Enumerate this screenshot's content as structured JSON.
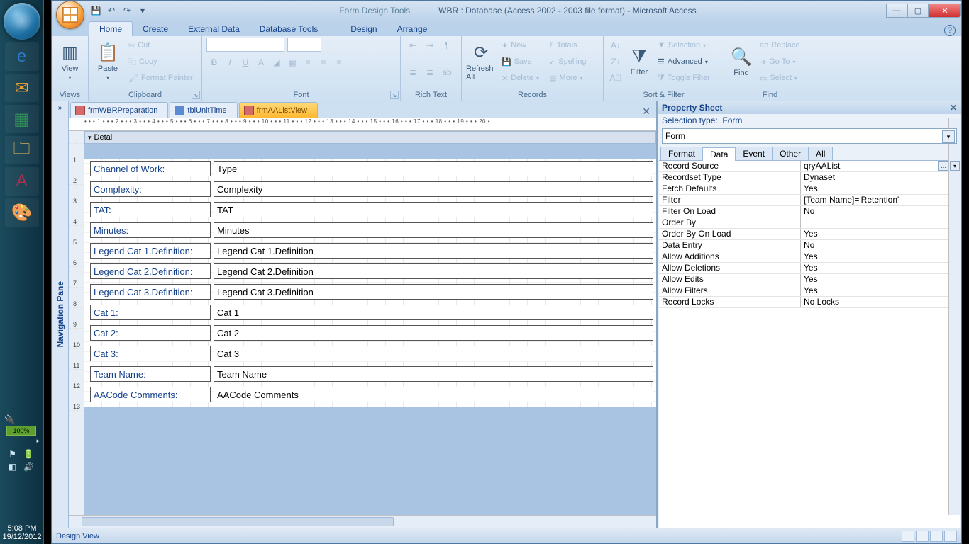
{
  "taskbar": {
    "battery": "100%",
    "time": "5:08 PM",
    "date": "19/12/2012"
  },
  "titlebar": {
    "tools_label": "Form Design Tools",
    "title": "WBR : Database (Access 2002 - 2003 file format) - Microsoft Access"
  },
  "ribbon_tabs": {
    "home": "Home",
    "create": "Create",
    "external": "External Data",
    "dbtools": "Database Tools",
    "design": "Design",
    "arrange": "Arrange"
  },
  "ribbon": {
    "views": {
      "view": "View",
      "group": "Views"
    },
    "clipboard": {
      "paste": "Paste",
      "cut": "Cut",
      "copy": "Copy",
      "fmt": "Format Painter",
      "group": "Clipboard"
    },
    "font": {
      "group": "Font"
    },
    "richtext": {
      "group": "Rich Text"
    },
    "records": {
      "refresh": "Refresh All",
      "new": "New",
      "save": "Save",
      "delete": "Delete",
      "totals": "Totals",
      "spelling": "Spelling",
      "more": "More",
      "group": "Records"
    },
    "sortfilter": {
      "filter": "Filter",
      "selection": "Selection",
      "advanced": "Advanced",
      "toggle": "Toggle Filter",
      "group": "Sort & Filter"
    },
    "find": {
      "find": "Find",
      "replace": "Replace",
      "goto": "Go To",
      "select": "Select",
      "group": "Find"
    }
  },
  "navpane": {
    "label": "Navigation Pane"
  },
  "doc_tabs": {
    "t1": "frmWBRPreparation",
    "t2": "tblUnitTime",
    "t3": "frmAAListView"
  },
  "detail_label": "Detail",
  "ruler": "• • • 1 • • • 2 • • • 3 • • • 4 • • • 5 • • • 6 • • • 7 • • • 8 • • • 9 • • • 10 • • • 11 • • • 12 • • • 13 • • • 14 • • • 15 • • • 16 • • • 17 • • • 18 • • • 19 • • • 20 •",
  "fields": [
    {
      "label": "Channel of Work:",
      "value": "Type"
    },
    {
      "label": "Complexity:",
      "value": "Complexity"
    },
    {
      "label": "TAT:",
      "value": "TAT"
    },
    {
      "label": "Minutes:",
      "value": "Minutes"
    },
    {
      "label": "Legend Cat 1.Definition:",
      "value": "Legend Cat 1.Definition"
    },
    {
      "label": "Legend Cat 2.Definition:",
      "value": "Legend Cat 2.Definition"
    },
    {
      "label": "Legend Cat 3.Definition:",
      "value": "Legend Cat 3.Definition"
    },
    {
      "label": "Cat 1:",
      "value": "Cat 1"
    },
    {
      "label": "Cat 2:",
      "value": "Cat 2"
    },
    {
      "label": "Cat 3:",
      "value": "Cat 3"
    },
    {
      "label": "Team Name:",
      "value": "Team Name"
    },
    {
      "label": "AACode Comments:",
      "value": "AACode Comments"
    }
  ],
  "prop": {
    "title": "Property Sheet",
    "seltype_label": "Selection type:",
    "seltype": "Form",
    "combo": "Form",
    "tabs": {
      "format": "Format",
      "data": "Data",
      "event": "Event",
      "other": "Other",
      "all": "All"
    },
    "rows": [
      {
        "k": "Record Source",
        "v": "qryAAList",
        "dd": true,
        "bld": true
      },
      {
        "k": "Recordset Type",
        "v": "Dynaset"
      },
      {
        "k": "Fetch Defaults",
        "v": "Yes"
      },
      {
        "k": "Filter",
        "v": "[Team Name]='Retention'"
      },
      {
        "k": "Filter On Load",
        "v": "No"
      },
      {
        "k": "Order By",
        "v": ""
      },
      {
        "k": "Order By On Load",
        "v": "Yes"
      },
      {
        "k": "Data Entry",
        "v": "No"
      },
      {
        "k": "Allow Additions",
        "v": "Yes"
      },
      {
        "k": "Allow Deletions",
        "v": "Yes"
      },
      {
        "k": "Allow Edits",
        "v": "Yes"
      },
      {
        "k": "Allow Filters",
        "v": "Yes"
      },
      {
        "k": "Record Locks",
        "v": "No Locks"
      }
    ]
  },
  "status": {
    "view": "Design View"
  }
}
